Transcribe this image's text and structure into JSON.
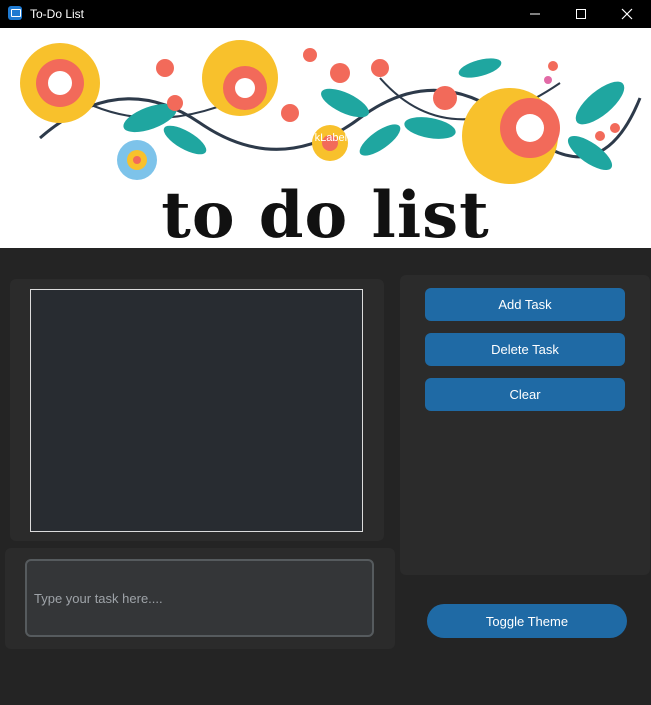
{
  "window": {
    "title": "To-Do List"
  },
  "banner": {
    "overlay_label": "CTkLabel",
    "title": "to do list"
  },
  "listbox": {
    "items": []
  },
  "buttons": {
    "add": "Add Task",
    "delete": "Delete Task",
    "clear": "Clear"
  },
  "entry": {
    "placeholder": "Type your task here....",
    "value": ""
  },
  "toggle": {
    "label": "Toggle Theme"
  },
  "colors": {
    "accent": "#1f6aa5",
    "window_bg": "#242424",
    "frame_bg": "#2b2b2b",
    "listbox_bg": "#282c31"
  },
  "icons": {
    "app": "app-window-icon",
    "minimize": "minimize-icon",
    "maximize": "maximize-icon",
    "close": "close-icon"
  }
}
